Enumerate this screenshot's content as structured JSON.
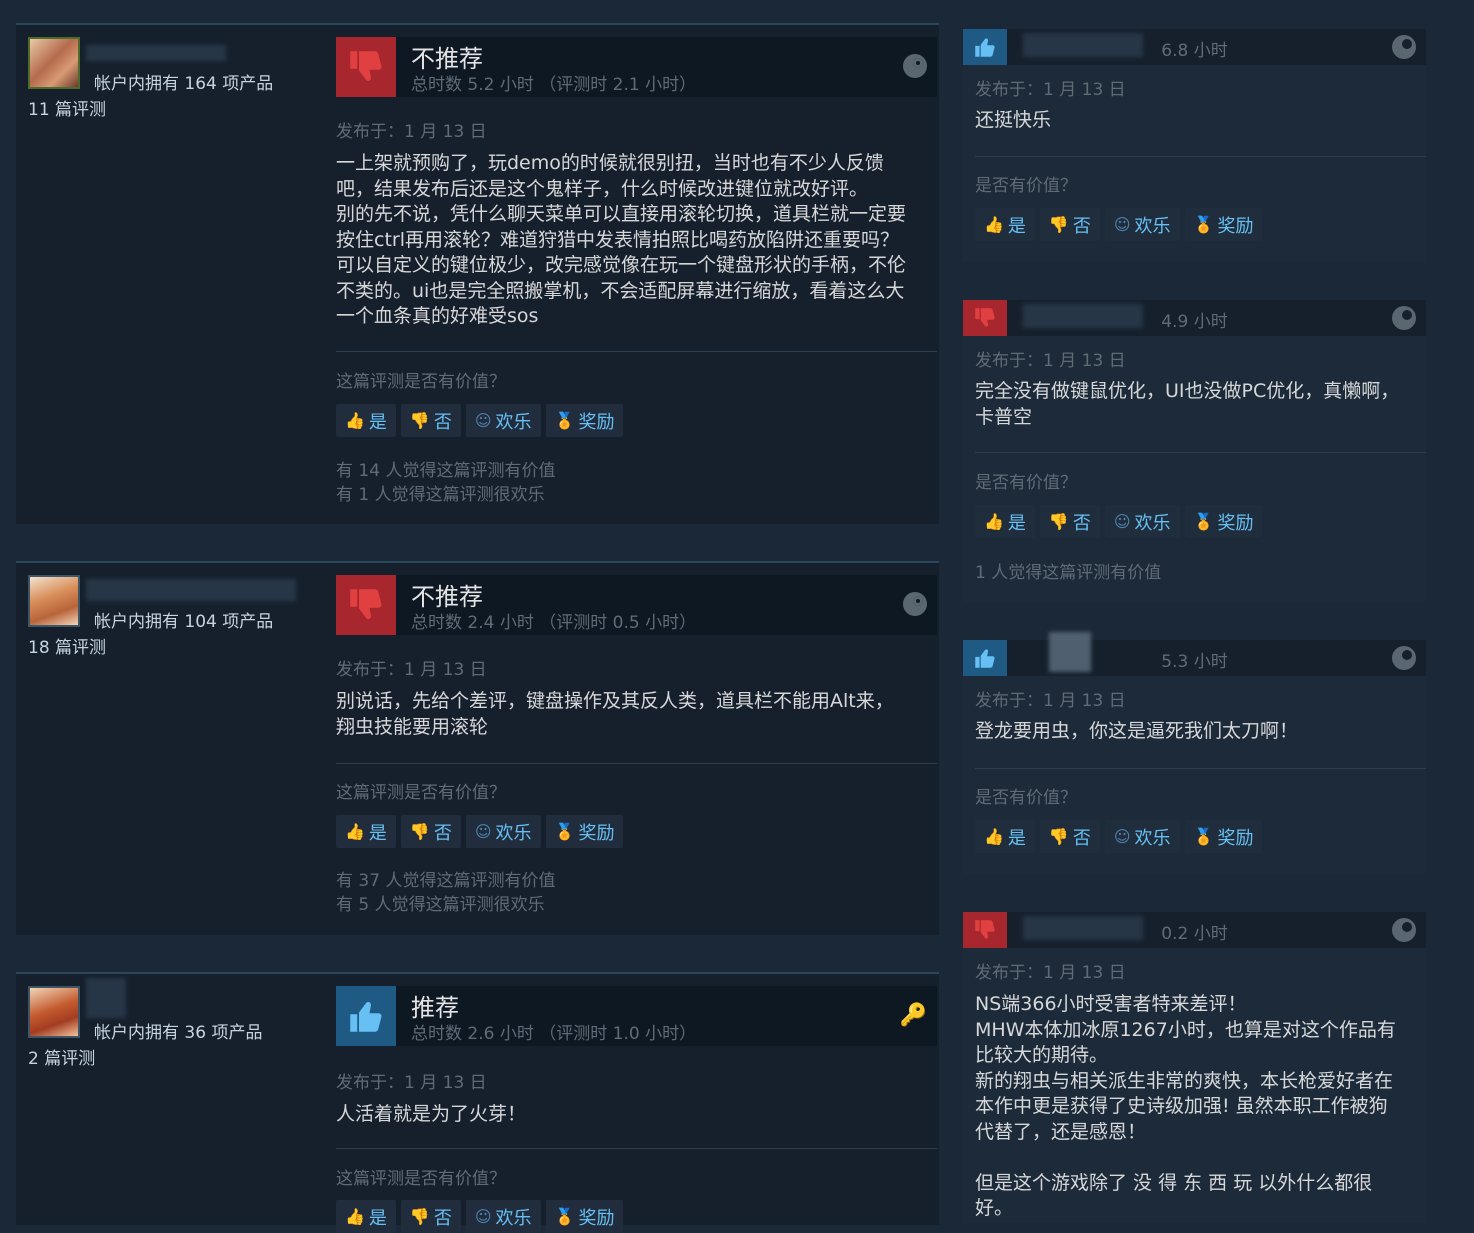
{
  "left_reviews": [
    {
      "products": "帐户内拥有 164 项产品",
      "review_count": "11 篇评测",
      "verdict": "不推荐",
      "hours": "总时数 5.2 小时 （评测时 2.1 小时）",
      "posted": "发布于：1 月 13 日",
      "content": "一上架就预购了，玩demo的时候就很别扭，当时也有不少人反馈\n吧，结果发布后还是这个鬼样子，什么时候改进键位就改好评。\n别的先不说，凭什么聊天菜单可以直接用滚轮切换，道具栏就一定要\n按住ctrl再用滚轮？难道狩猎中发表情拍照比喝药放陷阱还重要吗？\n可以自定义的键位极少，改完感觉像在玩一个键盘形状的手柄，不伦\n不类的。ui也是完全照搬掌机，不会适配屏幕进行缩放，看着这么大\n一个血条真的好难受sos",
      "helpful_q": "这篇评测是否有价值？",
      "stat1": "有 14 人觉得这篇评测有价值",
      "stat2": "有 1 人觉得这篇评测很欢乐"
    },
    {
      "products": "帐户内拥有 104 项产品",
      "review_count": "18 篇评测",
      "verdict": "不推荐",
      "hours": "总时数 2.4 小时 （评测时 0.5 小时）",
      "posted": "发布于：1 月 13 日",
      "content": "别说话，先给个差评，键盘操作及其反人类，道具栏不能用Alt来，\n翔虫技能要用滚轮",
      "helpful_q": "这篇评测是否有价值？",
      "stat1": "有 37 人觉得这篇评测有价值",
      "stat2": "有 5 人觉得这篇评测很欢乐"
    },
    {
      "products": "帐户内拥有 36 项产品",
      "review_count": "2 篇评测",
      "verdict": "推荐",
      "hours": "总时数 2.6 小时 （评测时 1.0 小时）",
      "posted": "发布于：1 月 13 日",
      "content": "人活着就是为了火芽！",
      "helpful_q": "这篇评测是否有价值？"
    }
  ],
  "right_reviews": [
    {
      "vote": "up",
      "hours": "6.8 小时",
      "posted": "发布于：1 月 13 日",
      "content": "还挺快乐",
      "helpful_q": "是否有价值？"
    },
    {
      "vote": "down",
      "hours": "4.9 小时",
      "posted": "发布于：1 月 13 日",
      "content": "完全没有做键鼠优化，UI也没做PC优化，真懒啊，\n卡普空",
      "helpful_q": "是否有价值？",
      "stat": "1 人觉得这篇评测有价值"
    },
    {
      "vote": "up",
      "hours": "5.3 小时",
      "posted": "发布于：1 月 13 日",
      "content": "登龙要用虫，你这是逼死我们太刀啊！",
      "helpful_q": "是否有价值？"
    },
    {
      "vote": "down",
      "hours": "0.2 小时",
      "posted": "发布于：1 月 13 日",
      "content": "NS端366小时受害者特来差评！\nMHW本体加冰原1267小时，也算是对这个作品有\n比较大的期待。\n新的翔虫与相关派生非常的爽快，本长枪爱好者在\n本作中更是获得了史诗级加强! 虽然本职工作被狗\n代替了，还是感恩！\n\n但是这个游戏除了 没 得 东 西 玩 以外什么都很\n好。"
    }
  ],
  "buttons": {
    "yes": "是",
    "no": "否",
    "funny": "欢乐",
    "award": "奖励"
  },
  "colors": {
    "background": "#1b2838",
    "card": "#16202d",
    "link": "#66c0f4",
    "thumb_down": "#a8262e",
    "thumb_up": "#1f5a85",
    "award": "#ffc82c"
  },
  "icons": {
    "thumbs_up": "thumbs-up-icon",
    "thumbs_down": "thumbs-down-icon",
    "steam": "steam-icon",
    "key": "key-icon",
    "smiley": "smiley-icon",
    "award": "award-icon"
  }
}
